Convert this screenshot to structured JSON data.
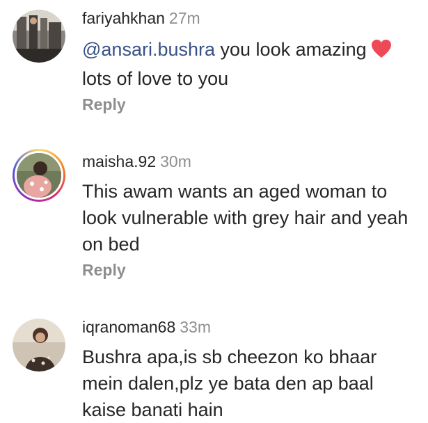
{
  "comments": [
    {
      "username": "fariyahkhan",
      "time": "27m",
      "mention": "@ansari.bushra",
      "text_after_mention": " you look amazing",
      "emoji": "heart-emoji",
      "text_line2": "lots of love to you",
      "reply_label": "Reply"
    },
    {
      "username": "maisha.92",
      "time": "30m",
      "text_line1": "This awam wants an aged woman to",
      "text_line2": "look vulnerable with grey hair and yeah",
      "text_line3": "on bed",
      "reply_label": "Reply"
    },
    {
      "username": "iqranoman68",
      "time": "33m",
      "text_line1": "Bushra apa,is sb cheezon ko bhaar",
      "text_line2": "mein dalen,plz ye bata den ap baal",
      "text_line3": "kaise banati hain"
    }
  ],
  "colors": {
    "text": "#262626",
    "muted": "#8e8e8e",
    "mention": "#385185",
    "heart": "#ed4956"
  }
}
